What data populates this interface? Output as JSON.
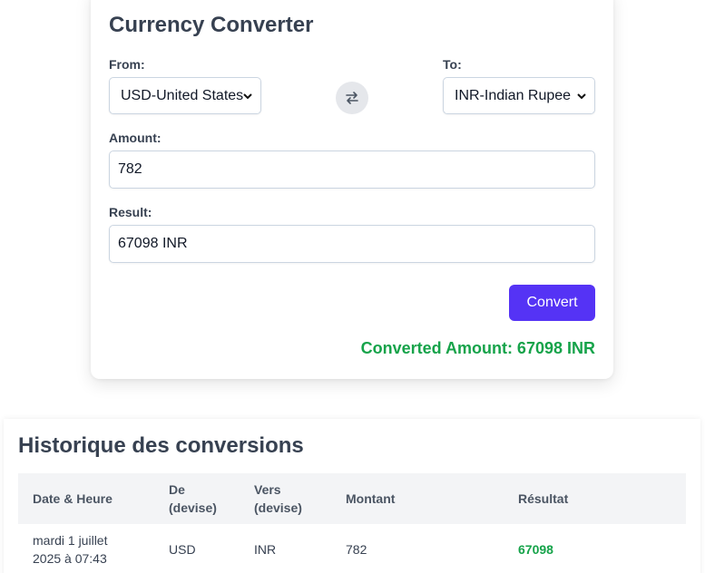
{
  "converter": {
    "title": "Currency Converter",
    "from_label": "From:",
    "from_value": "USD-United States",
    "to_label": "To:",
    "to_value": "INR-Indian Rupee",
    "swap_icon": "swap-arrows-icon",
    "amount_label": "Amount:",
    "amount_value": "782",
    "result_label": "Result:",
    "result_value": "67098 INR",
    "convert_label": "Convert",
    "converted_text": "Converted Amount: 67098 INR",
    "colors": {
      "accent": "#5533f5",
      "success": "#16a34a"
    }
  },
  "history": {
    "title": "Historique des conversions",
    "headers": {
      "date_line1": "Date & Heure",
      "from_line1": "De",
      "from_line2": "(devise)",
      "to_line1": "Vers",
      "to_line2": "(devise)",
      "amount": "Montant",
      "result": "Résultat"
    },
    "rows": [
      {
        "date_line1": "mardi 1 juillet",
        "date_line2": "2025 à 07:43",
        "from": "USD",
        "to": "INR",
        "amount": "782",
        "result": "67098"
      }
    ]
  }
}
